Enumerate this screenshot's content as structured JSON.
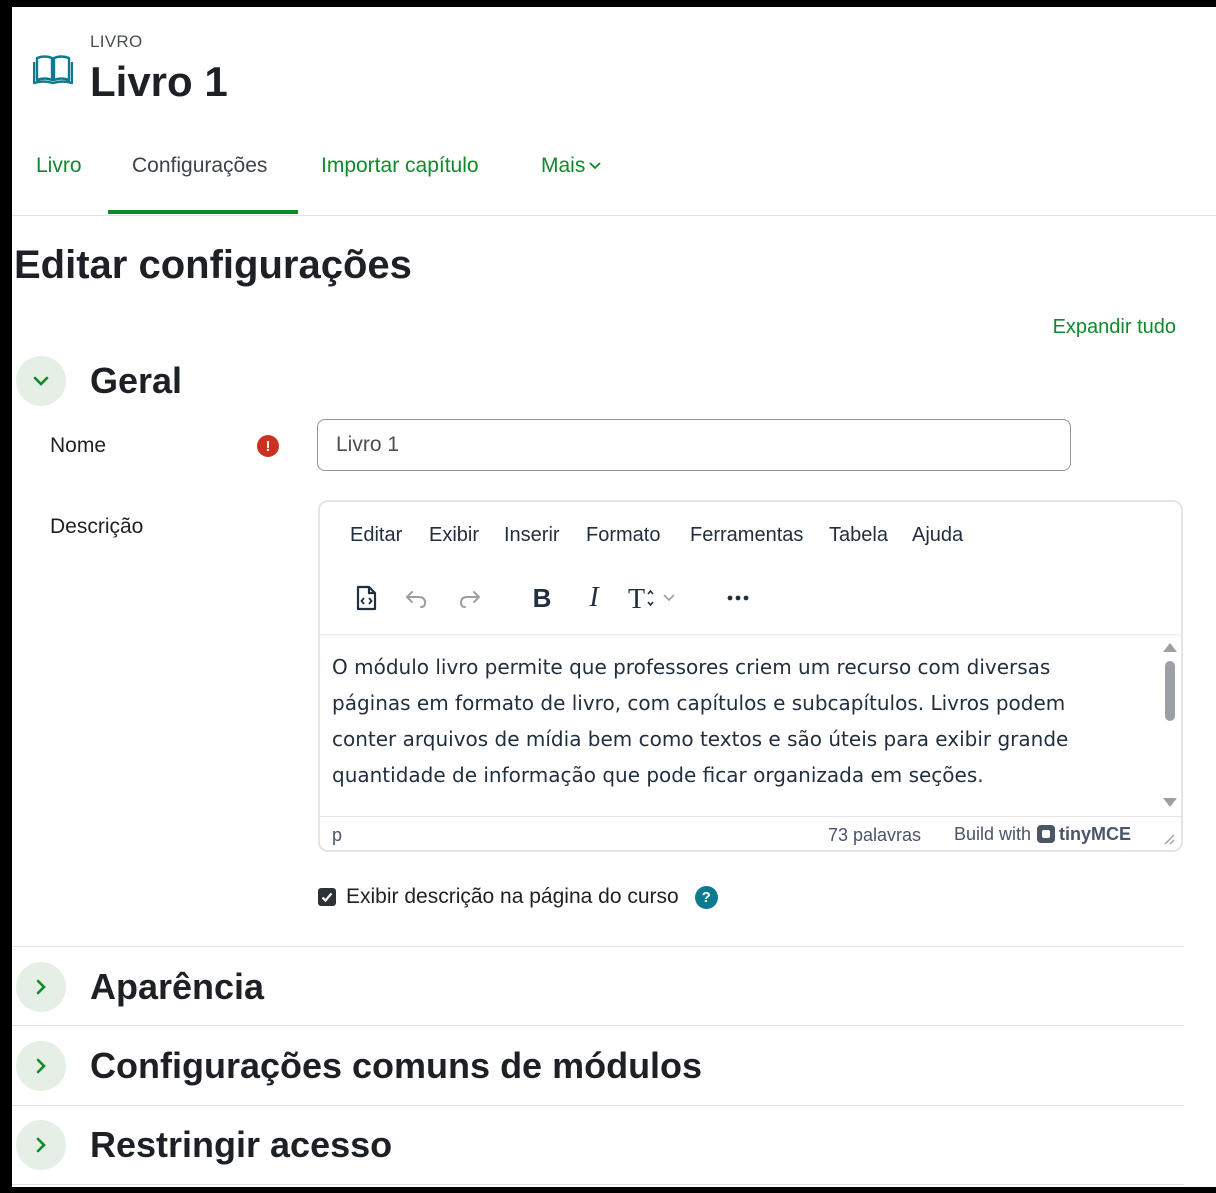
{
  "header": {
    "module_type": "LIVRO",
    "title": "Livro 1",
    "icon": "book-icon"
  },
  "tabs": [
    {
      "label": "Livro",
      "active": false
    },
    {
      "label": "Configurações",
      "active": true
    },
    {
      "label": "Importar capítulo",
      "active": false
    },
    {
      "label": "Mais",
      "active": false,
      "has_dropdown": true
    }
  ],
  "page_heading": "Editar configurações",
  "expand_all": "Expandir tudo",
  "sections": {
    "geral": {
      "title": "Geral",
      "expanded": true
    },
    "aparencia": {
      "title": "Aparência",
      "expanded": false
    },
    "comuns": {
      "title": "Configurações comuns de módulos",
      "expanded": false
    },
    "restringir": {
      "title": "Restringir acesso",
      "expanded": false
    }
  },
  "form": {
    "name_label": "Nome",
    "name_value": "Livro 1",
    "description_label": "Descrição",
    "required_icon": "!",
    "show_description_label": "Exibir descrição na página do curso",
    "show_description_checked": true,
    "help_icon": "?"
  },
  "editor": {
    "menu": [
      "Editar",
      "Exibir",
      "Inserir",
      "Formato",
      "Ferramentas",
      "Tabela",
      "Ajuda"
    ],
    "content": "O módulo livro permite que professores criem um recurso com diversas páginas em formato de livro, com capítulos e subcapítulos. Livros podem conter arquivos de mídia bem como textos e são úteis para exibir grande quantidade de informação que pode ficar organizada em seções.",
    "status_path": "p",
    "word_count": "73 palavras",
    "build_with": "Build with",
    "brand": "tinyMCE"
  },
  "colors": {
    "accent_green": "#0f8a2a",
    "required_red": "#ca3120",
    "help_teal": "#0d7a8f",
    "toggle_bg": "#e5efe5"
  }
}
